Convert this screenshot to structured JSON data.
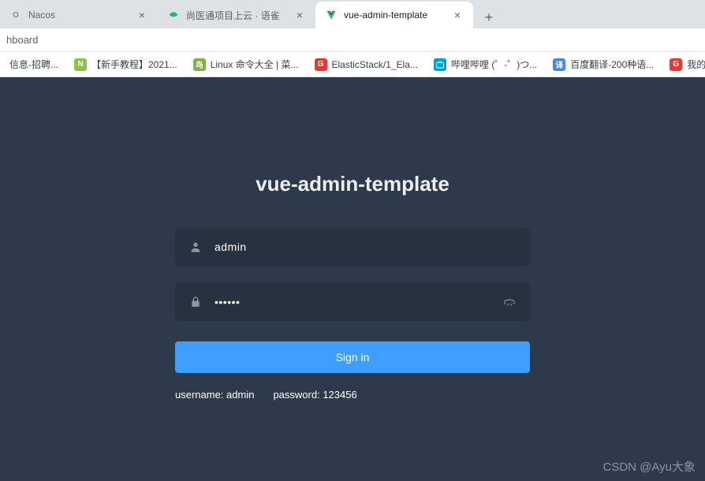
{
  "tabs": [
    {
      "title": "Nacos",
      "active": false
    },
    {
      "title": "尚医通项目上云 · 语雀",
      "active": false
    },
    {
      "title": "vue-admin-template",
      "active": true
    }
  ],
  "url_fragment": "hboard",
  "bookmarks": [
    {
      "label": "信息-招聘..."
    },
    {
      "label": "【新手教程】2021..."
    },
    {
      "label": "Linux 命令大全 | 菜..."
    },
    {
      "label": "ElasticStack/1_Ela..."
    },
    {
      "label": "哔哩哔哩 (゜-゜)つ..."
    },
    {
      "label": "百度翻译-200种语..."
    },
    {
      "label": "我的工"
    }
  ],
  "login": {
    "title": "vue-admin-template",
    "username_value": "admin",
    "password_value": "••••••",
    "signin_label": "Sign in",
    "tip_username": "username: admin",
    "tip_password": "password: 123456"
  },
  "watermark": "CSDN @Ayu大象"
}
